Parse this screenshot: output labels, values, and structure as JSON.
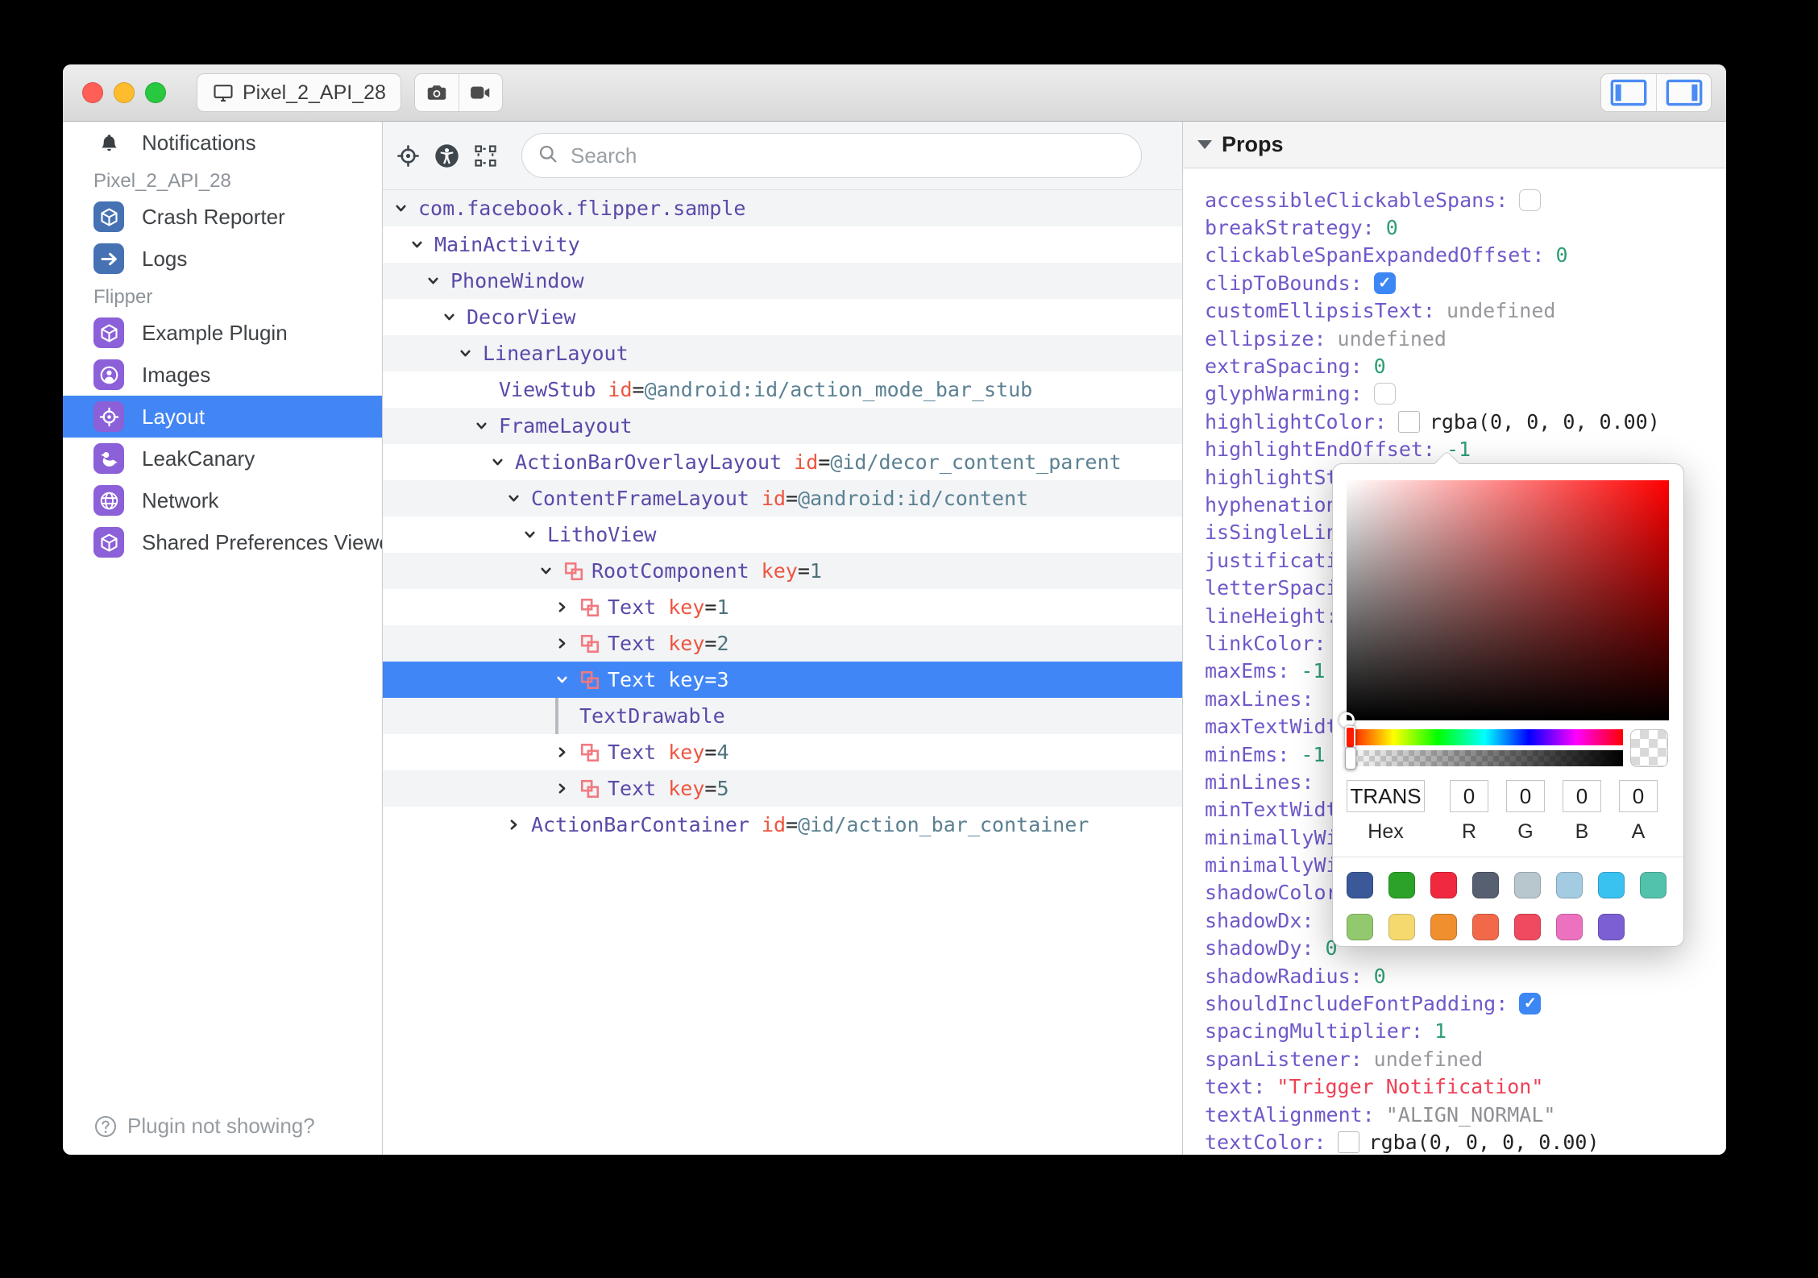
{
  "titlebar": {
    "device_button": "Pixel_2_API_28",
    "traffic_lights": [
      "#ff5f57",
      "#febc2e",
      "#28c840"
    ]
  },
  "sidebar": {
    "items": [
      {
        "kind": "plugin",
        "icon": "bell",
        "label": "Notifications"
      },
      {
        "kind": "section",
        "label": "Pixel_2_API_28"
      },
      {
        "kind": "plugin",
        "icon": "cube",
        "color": "#4672b4",
        "label": "Crash Reporter"
      },
      {
        "kind": "plugin",
        "icon": "arrow-right",
        "color": "#4672b4",
        "label": "Logs"
      },
      {
        "kind": "section",
        "label": "Flipper"
      },
      {
        "kind": "plugin",
        "icon": "cube",
        "color": "#8b60d8",
        "label": "Example Plugin"
      },
      {
        "kind": "plugin",
        "icon": "user",
        "color": "#8b60d8",
        "label": "Images"
      },
      {
        "kind": "plugin",
        "icon": "target",
        "color": "#8b60d8",
        "label": "Layout",
        "selected": true
      },
      {
        "kind": "plugin",
        "icon": "bird",
        "color": "#8b60d8",
        "label": "LeakCanary"
      },
      {
        "kind": "plugin",
        "icon": "globe",
        "color": "#8b60d8",
        "label": "Network"
      },
      {
        "kind": "plugin",
        "icon": "cube",
        "color": "#8b60d8",
        "label": "Shared Preferences Viewer"
      }
    ],
    "selected_color": "#4285f4",
    "footer": "Plugin not showing?"
  },
  "toolbar": {
    "search_placeholder": "Search"
  },
  "tree": {
    "selected_color": "#4086f7",
    "rows": [
      {
        "indent": 0,
        "chev": "down",
        "name": "com.facebook.flipper.sample"
      },
      {
        "indent": 1,
        "chev": "down",
        "name": "MainActivity"
      },
      {
        "indent": 2,
        "chev": "down",
        "name": "PhoneWindow"
      },
      {
        "indent": 3,
        "chev": "down",
        "name": "DecorView"
      },
      {
        "indent": 4,
        "chev": "down",
        "name": "LinearLayout"
      },
      {
        "indent": 5,
        "chev": "none",
        "name": "ViewStub",
        "attr_key": "id",
        "attr_val": "@android:id/action_mode_bar_stub"
      },
      {
        "indent": 5,
        "chev": "down",
        "name": "FrameLayout"
      },
      {
        "indent": 6,
        "chev": "down",
        "name": "ActionBarOverlayLayout",
        "attr_key": "id",
        "attr_val": "@id/decor_content_parent"
      },
      {
        "indent": 7,
        "chev": "down",
        "name": "ContentFrameLayout",
        "attr_key": "id",
        "attr_val": "@android:id/content"
      },
      {
        "indent": 8,
        "chev": "down",
        "name": "LithoView"
      },
      {
        "indent": 9,
        "chev": "down",
        "litho": true,
        "name": "RootComponent",
        "attr_key": "key",
        "attr_val": "1"
      },
      {
        "indent": 10,
        "chev": "right",
        "litho": true,
        "name": "Text",
        "attr_key": "key",
        "attr_val": "1"
      },
      {
        "indent": 10,
        "chev": "right",
        "litho": true,
        "name": "Text",
        "attr_key": "key",
        "attr_val": "2"
      },
      {
        "indent": 10,
        "chev": "down",
        "litho": true,
        "name": "Text",
        "attr_key": "key",
        "attr_val": "3",
        "selected": true
      },
      {
        "indent": 10,
        "chev": "none",
        "guide": true,
        "name": "TextDrawable"
      },
      {
        "indent": 10,
        "chev": "right",
        "litho": true,
        "name": "Text",
        "attr_key": "key",
        "attr_val": "4"
      },
      {
        "indent": 10,
        "chev": "right",
        "litho": true,
        "name": "Text",
        "attr_key": "key",
        "attr_val": "5"
      },
      {
        "indent": 7,
        "chev": "right",
        "name": "ActionBarContainer",
        "attr_key": "id",
        "attr_val": "@id/action_bar_container"
      }
    ]
  },
  "props": {
    "title": "Props",
    "rows": [
      {
        "name": "accessibleClickableSpans",
        "type": "checkbox-off",
        "value": ""
      },
      {
        "name": "breakStrategy",
        "type": "number",
        "value": "0"
      },
      {
        "name": "clickableSpanExpandedOffset",
        "type": "number",
        "value": "0"
      },
      {
        "name": "clipToBounds",
        "type": "checkbox-on",
        "value": ""
      },
      {
        "name": "customEllipsisText",
        "type": "undefined",
        "value": "undefined"
      },
      {
        "name": "ellipsize",
        "type": "undefined",
        "value": "undefined"
      },
      {
        "name": "extraSpacing",
        "type": "number",
        "value": "0"
      },
      {
        "name": "glyphWarming",
        "type": "checkbox-off",
        "value": ""
      },
      {
        "name": "highlightColor",
        "type": "color",
        "value": "rgba(0, 0, 0, 0.00)"
      },
      {
        "name": "highlightEndOffset",
        "type": "number",
        "value": "-1"
      },
      {
        "name": "highlightStartOffset",
        "type": "none",
        "value": ""
      },
      {
        "name": "hyphenationFrequency",
        "type": "none",
        "value": ""
      },
      {
        "name": "isSingleLine",
        "type": "none",
        "value": ""
      },
      {
        "name": "justificationMode",
        "type": "none",
        "value": ""
      },
      {
        "name": "letterSpacing",
        "type": "none",
        "value": ""
      },
      {
        "name": "lineHeight",
        "type": "none",
        "value": ""
      },
      {
        "name": "linkColor",
        "type": "none",
        "value": ""
      },
      {
        "name": "maxEms",
        "type": "number",
        "value": "-1"
      },
      {
        "name": "maxLines",
        "type": "none",
        "value": ""
      },
      {
        "name": "maxTextWidth",
        "type": "none",
        "value": ""
      },
      {
        "name": "minEms",
        "type": "number",
        "value": "-1"
      },
      {
        "name": "minLines",
        "type": "none",
        "value": ""
      },
      {
        "name": "minTextWidth",
        "type": "none",
        "value": ""
      },
      {
        "name": "minimallyWide",
        "type": "none",
        "value": ""
      },
      {
        "name": "minimallyWideThreshold",
        "type": "none",
        "value": ""
      },
      {
        "name": "shadowColor",
        "type": "none",
        "value": ""
      },
      {
        "name": "shadowDx",
        "type": "none",
        "value": ""
      },
      {
        "name": "shadowDy",
        "type": "number",
        "value": "0"
      },
      {
        "name": "shadowRadius",
        "type": "number",
        "value": "0"
      },
      {
        "name": "shouldIncludeFontPadding",
        "type": "checkbox-on",
        "value": ""
      },
      {
        "name": "spacingMultiplier",
        "type": "number",
        "value": "1"
      },
      {
        "name": "spanListener",
        "type": "undefined",
        "value": "undefined"
      },
      {
        "name": "text",
        "type": "string-red",
        "value": "\"Trigger Notification\""
      },
      {
        "name": "textAlignment",
        "type": "string-gray",
        "value": "\"ALIGN_NORMAL\""
      },
      {
        "name": "textColor",
        "type": "color",
        "value": "rgba(0, 0, 0, 0.00)"
      }
    ]
  },
  "picker": {
    "hex": "TRANS",
    "r": "0",
    "g": "0",
    "b": "0",
    "a": "0",
    "labels": [
      "Hex",
      "R",
      "G",
      "B",
      "A"
    ],
    "swatches": [
      [
        "#3b5998",
        "#2ba328",
        "#f0293e",
        "#576070",
        "#b8c6ce",
        "#a3cbe1",
        "#39c1ef",
        "#53c2ac"
      ],
      [
        "#93c96e",
        "#f5d96f",
        "#ef8f2e",
        "#f2694a",
        "#ef4a5f",
        "#ec71bf",
        "#7c5fd3"
      ]
    ]
  }
}
